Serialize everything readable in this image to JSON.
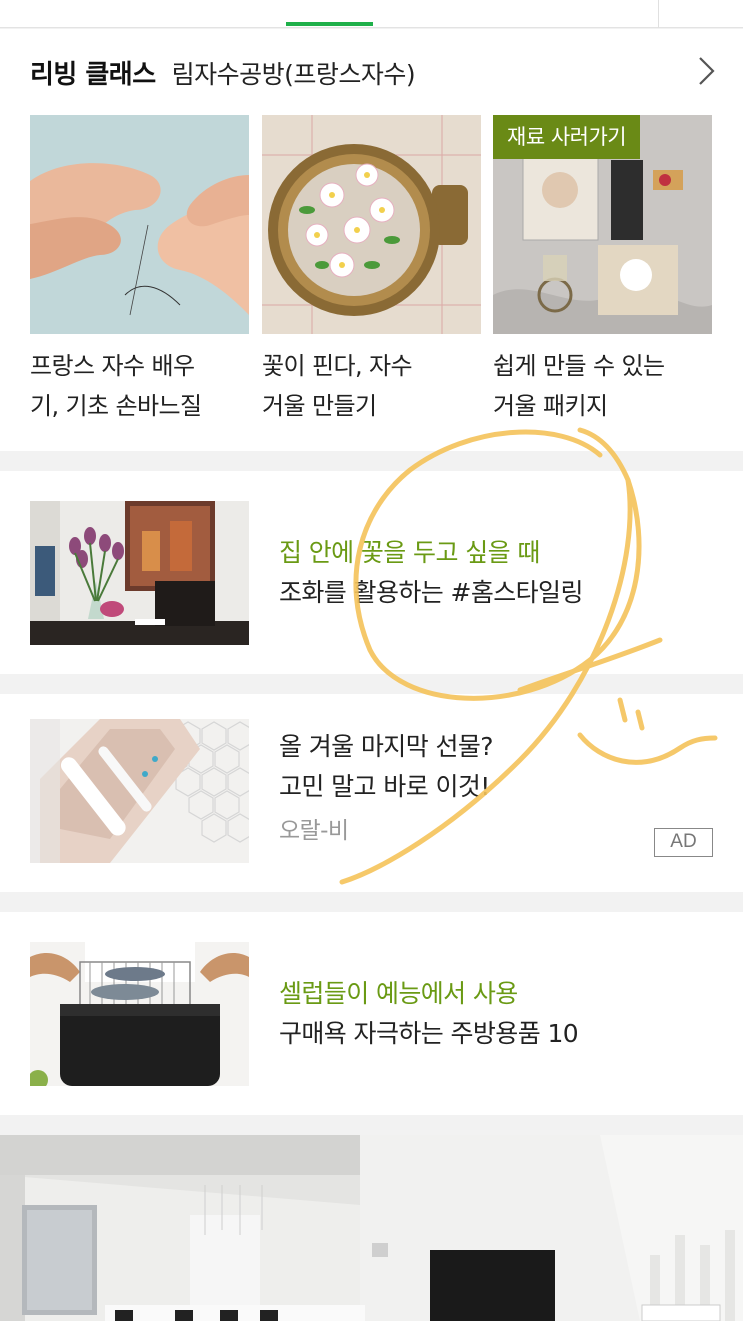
{
  "living_class": {
    "title": "리빙 클래스",
    "subtitle": "림자수공방(프랑스자수)",
    "items": [
      {
        "caption_line1": "프랑스 자수 배우",
        "caption_line2": "기, 기초 손바느질"
      },
      {
        "caption_line1": "꽃이 핀다, 자수",
        "caption_line2": "거울 만들기"
      },
      {
        "caption_line1": "쉽게 만들 수 있는",
        "caption_line2": "거울 패키지",
        "badge": "재료 사러가기"
      }
    ]
  },
  "articles": [
    {
      "headline": "집 안에 꽃을 두고 싶을 때",
      "subline": "조화를 활용하는 #홈스타일링"
    },
    {
      "line1": "올 겨울 마지막 선물?",
      "line2": "고민 말고 바로 이것!",
      "advertiser": "오랄-비",
      "ad_label": "AD"
    },
    {
      "headline": "셀럽들이 예능에서 사용",
      "subline": "구매욕 자극하는 주방용품 10"
    }
  ],
  "colors": {
    "accent_green": "#6a9a14",
    "tab_indicator": "#1fb04a",
    "badge_bg": "#6a8a16",
    "annotation": "#f5c35a"
  }
}
